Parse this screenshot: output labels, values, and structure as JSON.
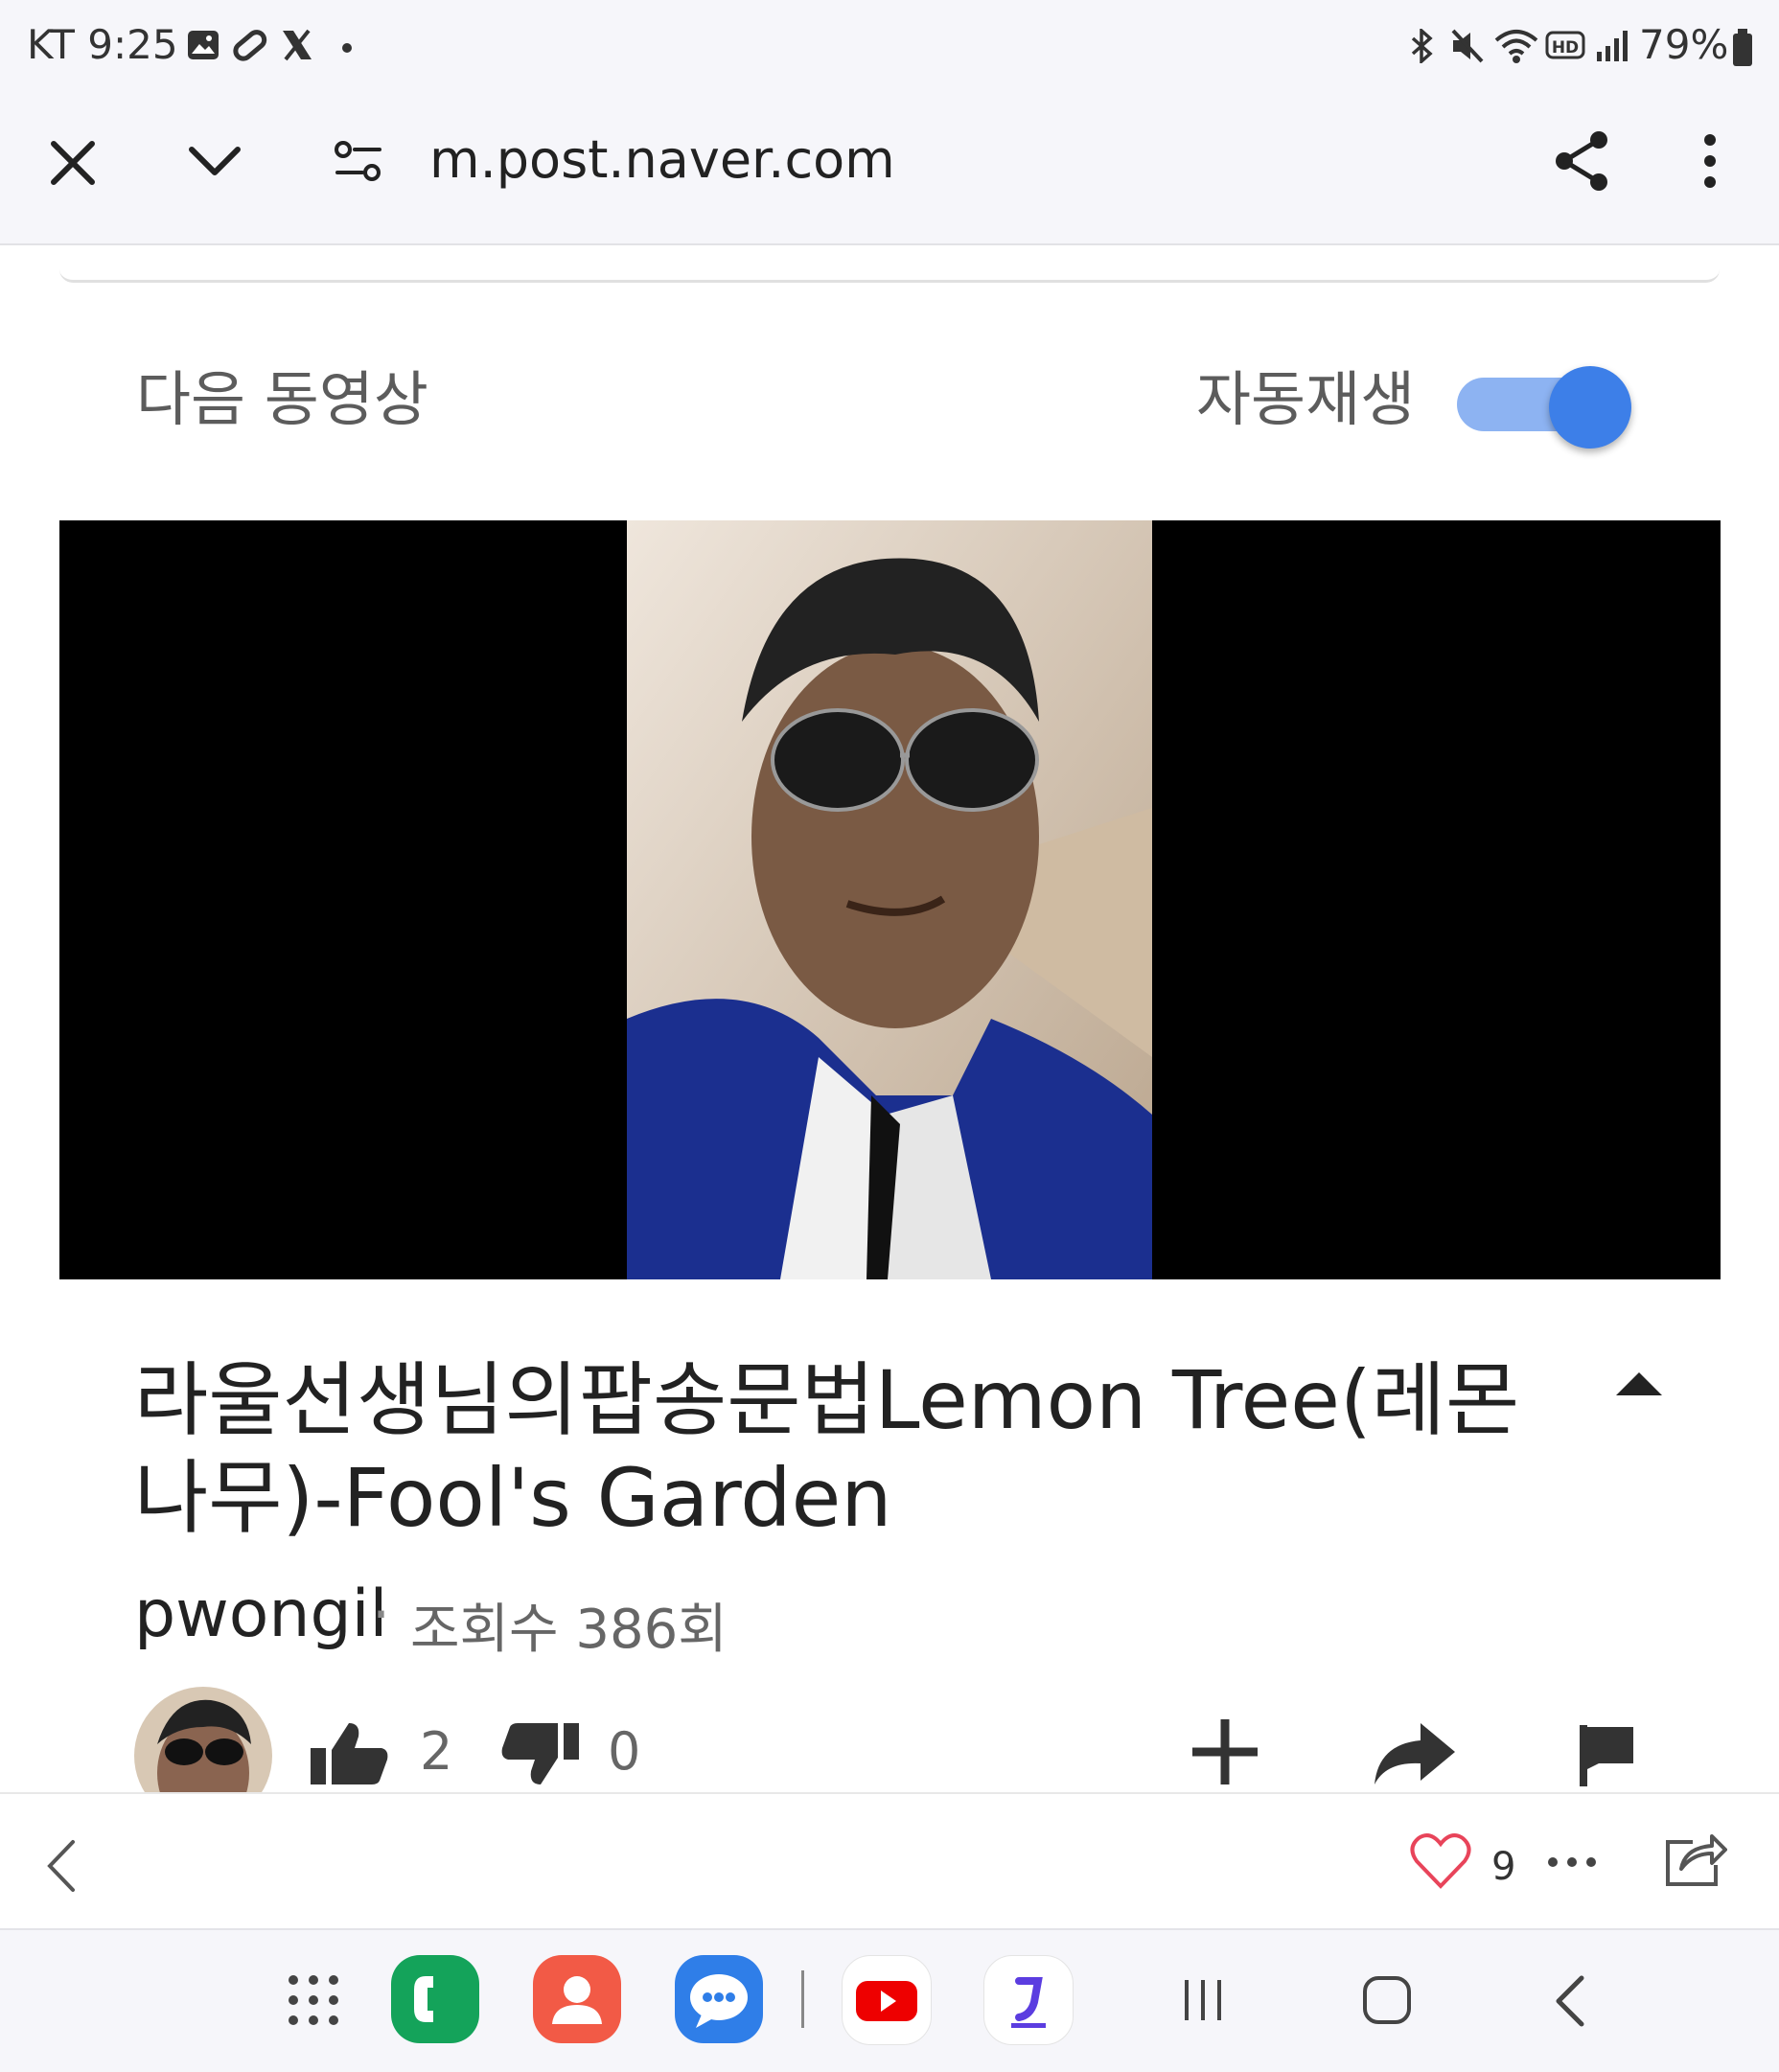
{
  "status_bar": {
    "carrier_time": "KT 9:25",
    "battery_text": "79%"
  },
  "browser": {
    "url": "m.post.naver.com"
  },
  "next_videos": {
    "label": "다음 동영상",
    "autoplay_label": "자동재생",
    "autoplay_on": true
  },
  "video": {
    "title": "라울선생님의팝송문법Lemon Tree(레몬 나무)-Fool's Garden",
    "channel": "pwongil",
    "separator": "·",
    "views": "조회수 386회",
    "likes": "2",
    "dislikes": "0"
  },
  "post_bar": {
    "heart_count": "9"
  },
  "colors": {
    "accent_blue": "#3d7fe8",
    "toggle_track": "#8db3f2",
    "heart_red": "#e8445a"
  }
}
